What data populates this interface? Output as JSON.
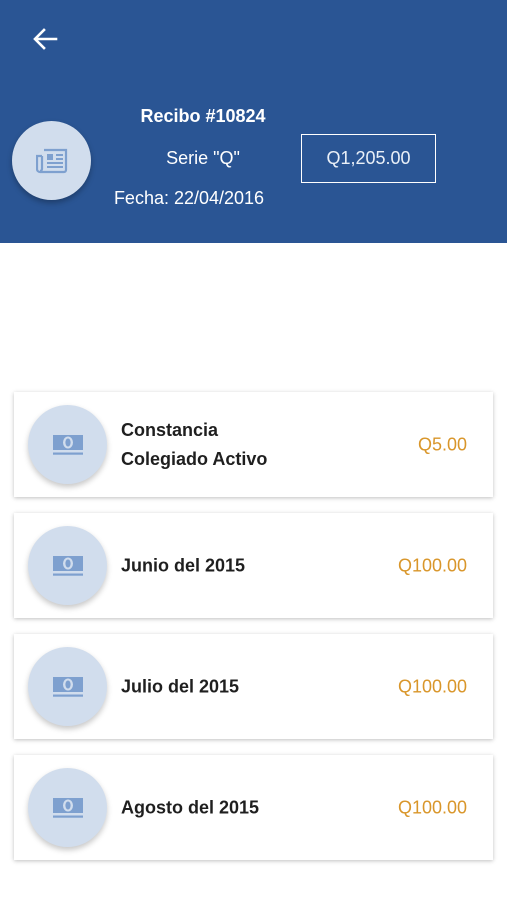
{
  "header": {
    "back_icon": "arrow-left-icon",
    "receipt_icon": "newspaper-icon",
    "recibo": "Recibo #10824",
    "serie": "Serie \"Q\"",
    "fecha": "Fecha: 22/04/2016",
    "total": "Q1,205.00",
    "background_color": "#2a5594"
  },
  "items": [
    {
      "label_line1": "Constancia",
      "label_line2": "Colegiado Activo",
      "amount": "Q5.00",
      "icon": "money-bill-icon"
    },
    {
      "label_line1": "Junio del 2015",
      "label_line2": "",
      "amount": "Q100.00",
      "icon": "money-bill-icon"
    },
    {
      "label_line1": "Julio del 2015",
      "label_line2": "",
      "amount": "Q100.00",
      "icon": "money-bill-icon"
    },
    {
      "label_line1": "Agosto del 2015",
      "label_line2": "",
      "amount": "Q100.00",
      "icon": "money-bill-icon"
    }
  ],
  "colors": {
    "amount": "#d9962a",
    "icon_circle": "#d1dded",
    "icon": "#7ea0cf"
  }
}
